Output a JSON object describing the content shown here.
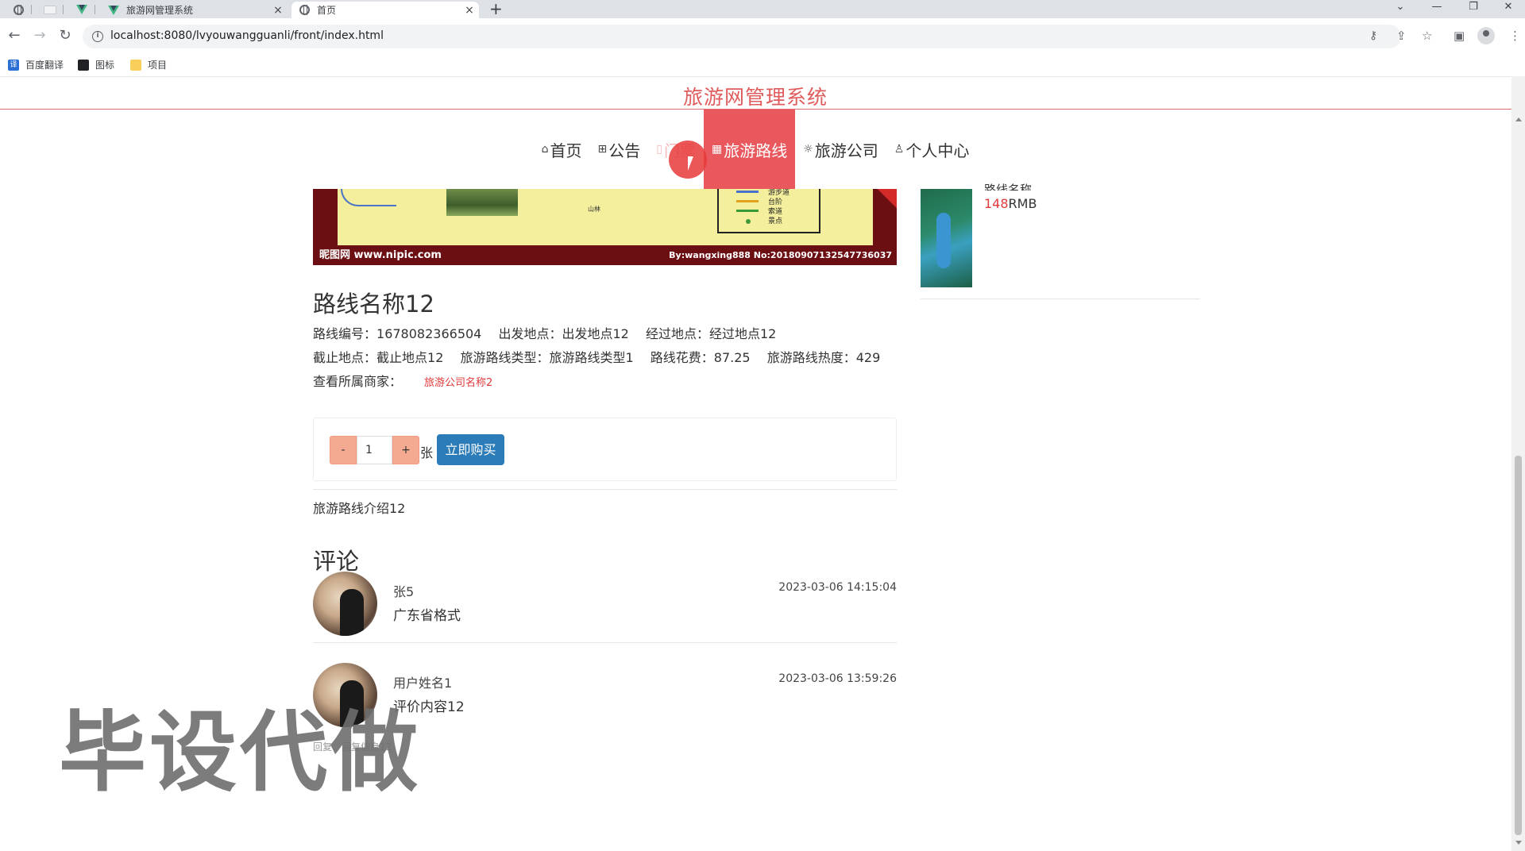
{
  "browser": {
    "tabs": [
      {
        "title": "旅游网管理系统",
        "icon": "vue-icon",
        "close": "×"
      },
      {
        "title": "首页",
        "icon": "globe-icon",
        "close": "×"
      }
    ],
    "new_tab": "+",
    "window_controls": [
      "⌄",
      "—",
      "❐",
      "✕"
    ],
    "nav": {
      "back": "←",
      "forward": "→",
      "reload": "↻"
    },
    "url": "localhost:8080/lvyouwangguanli/front/index.html",
    "omnibox_icons": [
      "key-icon",
      "share-icon",
      "star-icon"
    ],
    "toolbar_icons": [
      "sidepanel-icon",
      "profile-icon",
      "menu-icon"
    ],
    "bookmarks": [
      "百度翻译",
      "图标",
      "项目"
    ]
  },
  "site": {
    "title": "旅游网管理系统",
    "nav": [
      {
        "label": "首页",
        "icon": "⌂",
        "state": "normal"
      },
      {
        "label": "公告",
        "icon": "⊞",
        "state": "normal"
      },
      {
        "label": "门票",
        "icon": "▯",
        "state": "hover"
      },
      {
        "label": "旅游路线",
        "icon": "▦",
        "state": "active"
      },
      {
        "label": "旅游公司",
        "icon": "☼",
        "state": "normal"
      },
      {
        "label": "个人中心",
        "icon": "♙",
        "state": "normal"
      }
    ],
    "accent_color": "#e8585d"
  },
  "banner": {
    "watermark_left": "昵图网 www.nipic.com",
    "watermark_right": "By:wangxing888 No:20180907132547736037",
    "map_label": "山林",
    "legend": [
      "游步道",
      "台阶",
      "索道",
      "景点"
    ]
  },
  "route": {
    "title": "路线名称12",
    "line1": [
      {
        "label": "路线编号：",
        "value": "1678082366504"
      },
      {
        "label": "出发地点：",
        "value": "出发地点12"
      },
      {
        "label": "经过地点：",
        "value": "经过地点12"
      }
    ],
    "line2": [
      {
        "label": "截止地点：",
        "value": "截止地点12"
      },
      {
        "label": "旅游路线类型：",
        "value": "旅游路线类型1"
      },
      {
        "label": "路线花费：",
        "value": "87.25"
      },
      {
        "label": "旅游路线热度：",
        "value": "429"
      }
    ],
    "merchant_label": "查看所属商家：",
    "merchant_link": "旅游公司名称2",
    "qty_minus": "-",
    "qty_value": "1",
    "qty_plus": "+",
    "qty_unit": "张",
    "buy_label": "立即购买",
    "intro": "旅游路线介绍12"
  },
  "comments": {
    "title": "评论",
    "items": [
      {
        "user": "张5",
        "content": "广东省格式",
        "time": "2023-03-06 14:15:04",
        "reply": ""
      },
      {
        "user": "用户姓名1",
        "content": "评价内容12",
        "time": "2023-03-06 13:59:26",
        "reply": "回复：回复信息12"
      }
    ]
  },
  "sidebar": {
    "name": "路线名称",
    "price_num": "148",
    "price_unit": "RMB"
  },
  "overlay": {
    "watermark": "毕设代做"
  }
}
